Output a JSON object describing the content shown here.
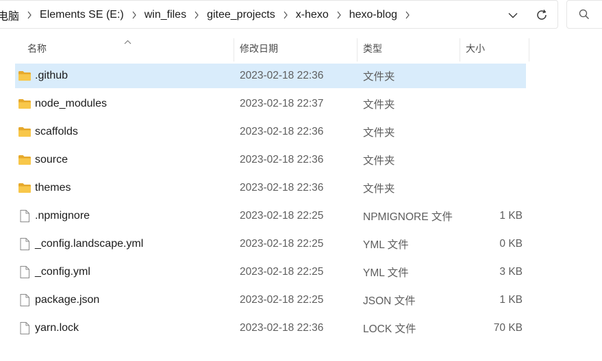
{
  "address": {
    "crumbs": [
      "电脑",
      "Elements SE (E:)",
      "win_files",
      "gitee_projects",
      "x-hexo",
      "hexo-blog"
    ]
  },
  "columns": {
    "name": "名称",
    "date": "修改日期",
    "type": "类型",
    "size": "大小"
  },
  "files": [
    {
      "name": ".github",
      "date": "2023-02-18 22:36",
      "type": "文件夹",
      "size": "",
      "kind": "folder",
      "selected": true
    },
    {
      "name": "node_modules",
      "date": "2023-02-18 22:37",
      "type": "文件夹",
      "size": "",
      "kind": "folder",
      "selected": false
    },
    {
      "name": "scaffolds",
      "date": "2023-02-18 22:36",
      "type": "文件夹",
      "size": "",
      "kind": "folder",
      "selected": false
    },
    {
      "name": "source",
      "date": "2023-02-18 22:36",
      "type": "文件夹",
      "size": "",
      "kind": "folder",
      "selected": false
    },
    {
      "name": "themes",
      "date": "2023-02-18 22:36",
      "type": "文件夹",
      "size": "",
      "kind": "folder",
      "selected": false
    },
    {
      "name": ".npmignore",
      "date": "2023-02-18 22:25",
      "type": "NPMIGNORE 文件",
      "size": "1 KB",
      "kind": "file",
      "selected": false
    },
    {
      "name": "_config.landscape.yml",
      "date": "2023-02-18 22:25",
      "type": "YML 文件",
      "size": "0 KB",
      "kind": "file",
      "selected": false
    },
    {
      "name": "_config.yml",
      "date": "2023-02-18 22:25",
      "type": "YML 文件",
      "size": "3 KB",
      "kind": "file",
      "selected": false
    },
    {
      "name": "package.json",
      "date": "2023-02-18 22:25",
      "type": "JSON 文件",
      "size": "1 KB",
      "kind": "file",
      "selected": false
    },
    {
      "name": "yarn.lock",
      "date": "2023-02-18 22:36",
      "type": "LOCK 文件",
      "size": "70 KB",
      "kind": "file",
      "selected": false
    }
  ],
  "colors": {
    "selection": "#d9ecfb",
    "folder": "#f8c74a",
    "folder_dark": "#e6a92c"
  }
}
